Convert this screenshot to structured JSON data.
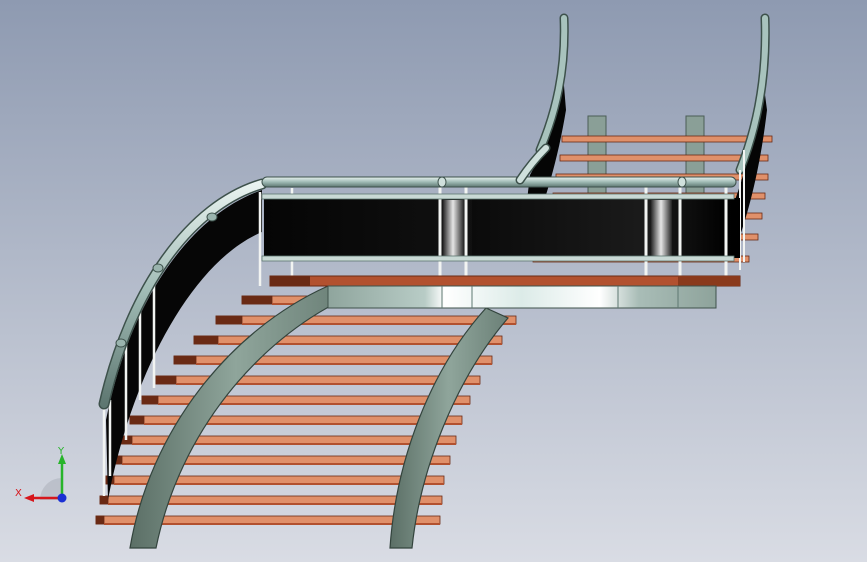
{
  "viewport": {
    "background_top": "#8e9ab1",
    "background_bottom": "#d9dce4"
  },
  "model": {
    "tread_color": "#e0906a",
    "tread_edge_color": "#b2512f",
    "tread_end_color": "#6a2a14",
    "stringer_color": "#7f9488",
    "rail_color": "#a8c3bd",
    "panel_color": "#0c0c0c",
    "post_color": "#f2f4f2"
  },
  "triad": {
    "x_label": "X",
    "y_label": "Y",
    "x_color": "#d6161c",
    "y_color": "#27b42a",
    "z_color": "#1a2fd4"
  }
}
